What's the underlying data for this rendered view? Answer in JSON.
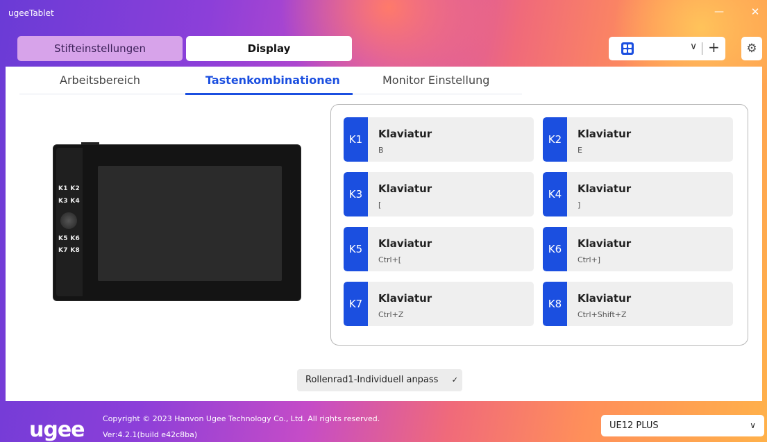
{
  "window": {
    "title": "ugeeTablet",
    "minimize": "—",
    "close": "✕"
  },
  "top_tabs": [
    {
      "label": "Stifteinstellungen",
      "active": false
    },
    {
      "label": "Display",
      "active": true
    }
  ],
  "profile_bar": {
    "icon": "grid-icon",
    "dropdown": "chevron-down-icon",
    "add": "+"
  },
  "settings": {
    "icon": "⚙"
  },
  "sub_tabs": [
    {
      "label": "Arbeitsbereich",
      "active": false
    },
    {
      "label": "Tastenkombinationen",
      "active": true
    },
    {
      "label": "Monitor Einstellung",
      "active": false
    }
  ],
  "tablet_labels": [
    "K1 K2",
    "K3 K4",
    "K5 K6",
    "K7 K8"
  ],
  "keys": [
    {
      "id": "K1",
      "name": "Klaviatur",
      "value": "B"
    },
    {
      "id": "K2",
      "name": "Klaviatur",
      "value": "E"
    },
    {
      "id": "K3",
      "name": "Klaviatur",
      "value": "["
    },
    {
      "id": "K4",
      "name": "Klaviatur",
      "value": "]"
    },
    {
      "id": "K5",
      "name": "Klaviatur",
      "value": "Ctrl+["
    },
    {
      "id": "K6",
      "name": "Klaviatur",
      "value": "Ctrl+]"
    },
    {
      "id": "K7",
      "name": "Klaviatur",
      "value": "Ctrl+Z"
    },
    {
      "id": "K8",
      "name": "Klaviatur",
      "value": "Ctrl+Shift+Z"
    }
  ],
  "roller": {
    "label": "Rollenrad1-Individuell anpass",
    "chevron": "✓"
  },
  "footer": {
    "logo": "ugee",
    "copyright": "Copyright © 2023 Hanvon Ugee Technology Co., Ltd. All rights reserved.",
    "version": "Ver:4.2.1(build e42c8ba)",
    "device": "UE12 PLUS"
  },
  "colors": {
    "accent": "#1b4fe0",
    "pen_tab": "#d7a3ea"
  }
}
